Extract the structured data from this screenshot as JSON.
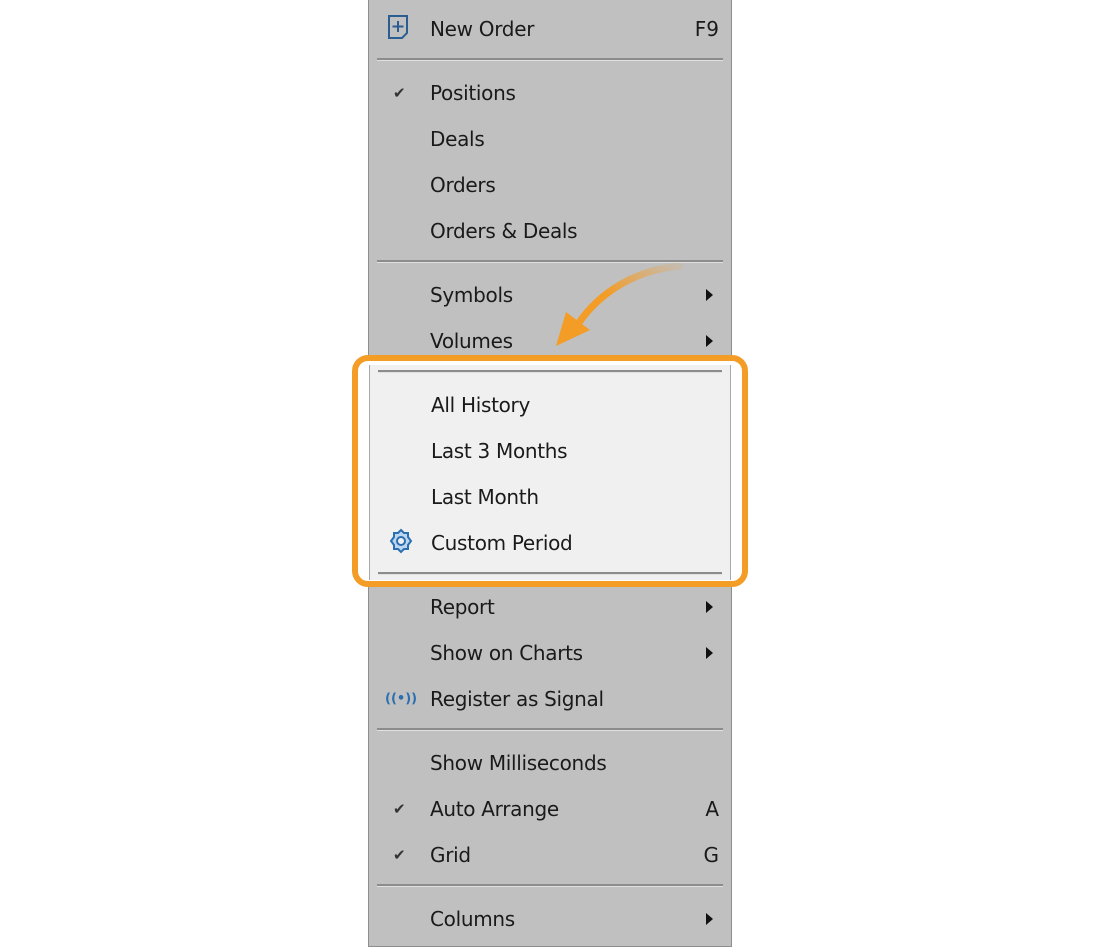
{
  "menu": {
    "new_order": {
      "label": "New Order",
      "shortcut": "F9",
      "icon": "new-order-icon"
    },
    "view_items": [
      {
        "label": "Positions",
        "checked": true
      },
      {
        "label": "Deals",
        "checked": false
      },
      {
        "label": "Orders",
        "checked": false
      },
      {
        "label": "Orders & Deals",
        "checked": false
      }
    ],
    "symbols": {
      "label": "Symbols",
      "submenu": true
    },
    "volumes": {
      "label": "Volumes",
      "submenu": true
    },
    "period_items": [
      {
        "label": "All History"
      },
      {
        "label": "Last 3 Months"
      },
      {
        "label": "Last Month"
      },
      {
        "label": "Custom Period",
        "icon": "gear-icon"
      }
    ],
    "report": {
      "label": "Report",
      "submenu": true
    },
    "show_on_charts": {
      "label": "Show on Charts",
      "submenu": true
    },
    "register_signal": {
      "label": "Register as Signal",
      "icon": "signal-icon"
    },
    "show_ms": {
      "label": "Show Milliseconds",
      "checked": false
    },
    "auto_arrange": {
      "label": "Auto Arrange",
      "shortcut": "A",
      "checked": true
    },
    "grid": {
      "label": "Grid",
      "shortcut": "G",
      "checked": true
    },
    "columns": {
      "label": "Columns",
      "submenu": true
    }
  },
  "colors": {
    "menu_bg": "#c0c0c0",
    "highlight_border": "#f39c26",
    "highlight_bg": "#f0f0f0",
    "icon_blue": "#2a6fb0"
  }
}
